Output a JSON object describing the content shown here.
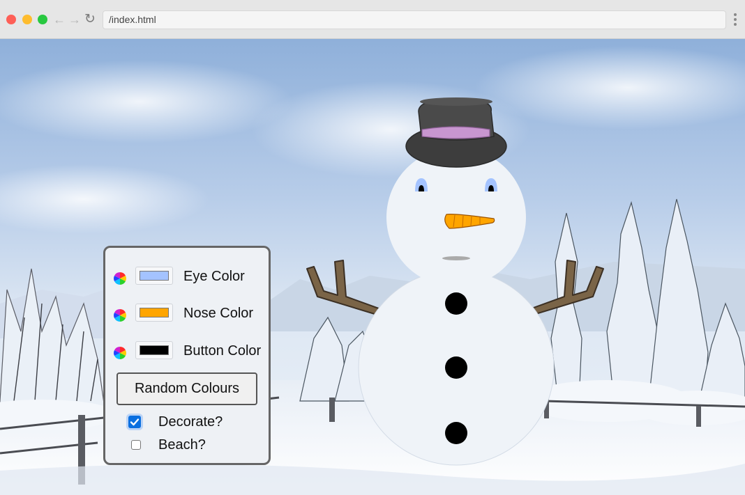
{
  "browser": {
    "url": "/index.html"
  },
  "controls": {
    "eye": {
      "label": "Eye Color",
      "color": "#a4c3ff"
    },
    "nose": {
      "label": "Nose Color",
      "color": "#ffa500"
    },
    "button": {
      "label": "Button Color",
      "color": "#000000"
    },
    "random_label": "Random Colours",
    "decorate": {
      "label": "Decorate?",
      "checked": true
    },
    "beach": {
      "label": "Beach?",
      "checked": false
    }
  },
  "snowman": {
    "hat_band_color": "#c896d0",
    "body_color": "#eff3f8",
    "arm_color": "#7a6447",
    "button_count": 3
  }
}
